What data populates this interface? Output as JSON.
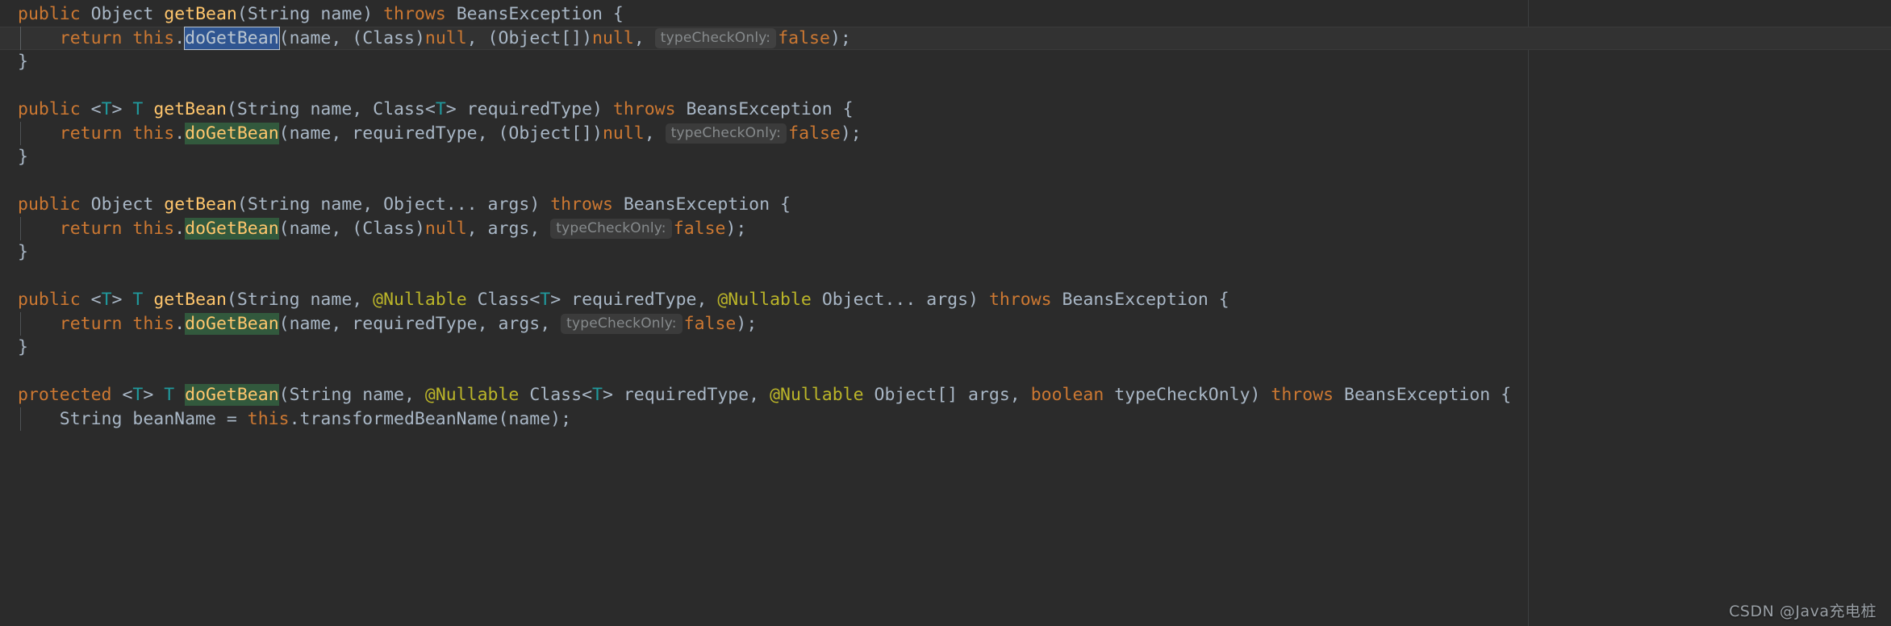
{
  "editor": {
    "theme": "darcula",
    "background": "#2b2b2b",
    "caret_line_background": "#323232",
    "right_margin_guide_x": 1894,
    "colors": {
      "keyword": "#cc7832",
      "default_text": "#a9b7c6",
      "method_declaration": "#ffc66d",
      "annotation": "#bbb529",
      "type_parameter": "#20999d",
      "usage_highlight_bg": "#32593d",
      "selection_bg": "#2f5591",
      "inline_hint_fg": "#868a8c",
      "inline_hint_bg": "#3b3b3b",
      "indent_guide": "#4f5356"
    },
    "inline_hint_label": "typeCheckOnly:",
    "lines": [
      {
        "n": 1,
        "caret": false,
        "indent_guide": false,
        "tokens": [
          {
            "t": "public",
            "c": "kw"
          },
          {
            "t": " ",
            "c": "plain"
          },
          {
            "t": "Object",
            "c": "type"
          },
          {
            "t": " ",
            "c": "plain"
          },
          {
            "t": "getBean",
            "c": "mname"
          },
          {
            "t": "(",
            "c": "plain"
          },
          {
            "t": "String",
            "c": "type"
          },
          {
            "t": " name) ",
            "c": "plain"
          },
          {
            "t": "throws",
            "c": "kw"
          },
          {
            "t": " BeansException {",
            "c": "plain"
          }
        ]
      },
      {
        "n": 2,
        "caret": true,
        "indent_guide": true,
        "tokens": [
          {
            "t": "    ",
            "c": "plain"
          },
          {
            "t": "return",
            "c": "kw"
          },
          {
            "t": " ",
            "c": "plain"
          },
          {
            "t": "this",
            "c": "kw"
          },
          {
            "t": ".",
            "c": "plain"
          },
          {
            "t": "doGetBean",
            "c": "selection"
          },
          {
            "t": "(name, (",
            "c": "plain"
          },
          {
            "t": "Class",
            "c": "type"
          },
          {
            "t": ")",
            "c": "plain"
          },
          {
            "t": "null",
            "c": "kw"
          },
          {
            "t": ", (",
            "c": "plain"
          },
          {
            "t": "Object",
            "c": "type"
          },
          {
            "t": "[])",
            "c": "plain"
          },
          {
            "t": "null",
            "c": "kw"
          },
          {
            "t": ", ",
            "c": "plain"
          },
          {
            "t": "typeCheckOnly:",
            "c": "hint"
          },
          {
            "t": "false",
            "c": "kw"
          },
          {
            "t": ");",
            "c": "plain"
          }
        ]
      },
      {
        "n": 3,
        "caret": false,
        "indent_guide": false,
        "tokens": [
          {
            "t": "}",
            "c": "plain"
          }
        ]
      },
      {
        "n": 4,
        "caret": false,
        "indent_guide": false,
        "tokens": []
      },
      {
        "n": 5,
        "caret": false,
        "indent_guide": false,
        "tokens": [
          {
            "t": "public",
            "c": "kw"
          },
          {
            "t": " <",
            "c": "plain"
          },
          {
            "t": "T",
            "c": "generic"
          },
          {
            "t": "> ",
            "c": "plain"
          },
          {
            "t": "T",
            "c": "generic"
          },
          {
            "t": " ",
            "c": "plain"
          },
          {
            "t": "getBean",
            "c": "mname"
          },
          {
            "t": "(",
            "c": "plain"
          },
          {
            "t": "String",
            "c": "type"
          },
          {
            "t": " name, ",
            "c": "plain"
          },
          {
            "t": "Class",
            "c": "type"
          },
          {
            "t": "<",
            "c": "plain"
          },
          {
            "t": "T",
            "c": "generic"
          },
          {
            "t": "> requiredType) ",
            "c": "plain"
          },
          {
            "t": "throws",
            "c": "kw"
          },
          {
            "t": " BeansException {",
            "c": "plain"
          }
        ]
      },
      {
        "n": 6,
        "caret": false,
        "indent_guide": true,
        "tokens": [
          {
            "t": "    ",
            "c": "plain"
          },
          {
            "t": "return",
            "c": "kw"
          },
          {
            "t": " ",
            "c": "plain"
          },
          {
            "t": "this",
            "c": "kw"
          },
          {
            "t": ".",
            "c": "plain"
          },
          {
            "t": "doGetBean",
            "c": "usage"
          },
          {
            "t": "(name, requiredType, (",
            "c": "plain"
          },
          {
            "t": "Object",
            "c": "type"
          },
          {
            "t": "[])",
            "c": "plain"
          },
          {
            "t": "null",
            "c": "kw"
          },
          {
            "t": ", ",
            "c": "plain"
          },
          {
            "t": "typeCheckOnly:",
            "c": "hint"
          },
          {
            "t": "false",
            "c": "kw"
          },
          {
            "t": ");",
            "c": "plain"
          }
        ]
      },
      {
        "n": 7,
        "caret": false,
        "indent_guide": false,
        "tokens": [
          {
            "t": "}",
            "c": "plain"
          }
        ]
      },
      {
        "n": 8,
        "caret": false,
        "indent_guide": false,
        "tokens": []
      },
      {
        "n": 9,
        "caret": false,
        "indent_guide": false,
        "tokens": [
          {
            "t": "public",
            "c": "kw"
          },
          {
            "t": " ",
            "c": "plain"
          },
          {
            "t": "Object",
            "c": "type"
          },
          {
            "t": " ",
            "c": "plain"
          },
          {
            "t": "getBean",
            "c": "mname"
          },
          {
            "t": "(",
            "c": "plain"
          },
          {
            "t": "String",
            "c": "type"
          },
          {
            "t": " name, ",
            "c": "plain"
          },
          {
            "t": "Object",
            "c": "type"
          },
          {
            "t": "... args) ",
            "c": "plain"
          },
          {
            "t": "throws",
            "c": "kw"
          },
          {
            "t": " BeansException {",
            "c": "plain"
          }
        ]
      },
      {
        "n": 10,
        "caret": false,
        "indent_guide": true,
        "tokens": [
          {
            "t": "    ",
            "c": "plain"
          },
          {
            "t": "return",
            "c": "kw"
          },
          {
            "t": " ",
            "c": "plain"
          },
          {
            "t": "this",
            "c": "kw"
          },
          {
            "t": ".",
            "c": "plain"
          },
          {
            "t": "doGetBean",
            "c": "usage"
          },
          {
            "t": "(name, (",
            "c": "plain"
          },
          {
            "t": "Class",
            "c": "type"
          },
          {
            "t": ")",
            "c": "plain"
          },
          {
            "t": "null",
            "c": "kw"
          },
          {
            "t": ", args, ",
            "c": "plain"
          },
          {
            "t": "typeCheckOnly:",
            "c": "hint"
          },
          {
            "t": "false",
            "c": "kw"
          },
          {
            "t": ");",
            "c": "plain"
          }
        ]
      },
      {
        "n": 11,
        "caret": false,
        "indent_guide": false,
        "tokens": [
          {
            "t": "}",
            "c": "plain"
          }
        ]
      },
      {
        "n": 12,
        "caret": false,
        "indent_guide": false,
        "tokens": []
      },
      {
        "n": 13,
        "caret": false,
        "indent_guide": false,
        "tokens": [
          {
            "t": "public",
            "c": "kw"
          },
          {
            "t": " <",
            "c": "plain"
          },
          {
            "t": "T",
            "c": "generic"
          },
          {
            "t": "> ",
            "c": "plain"
          },
          {
            "t": "T",
            "c": "generic"
          },
          {
            "t": " ",
            "c": "plain"
          },
          {
            "t": "getBean",
            "c": "mname"
          },
          {
            "t": "(",
            "c": "plain"
          },
          {
            "t": "String",
            "c": "type"
          },
          {
            "t": " name, ",
            "c": "plain"
          },
          {
            "t": "@Nullable",
            "c": "anno"
          },
          {
            "t": " ",
            "c": "plain"
          },
          {
            "t": "Class",
            "c": "type"
          },
          {
            "t": "<",
            "c": "plain"
          },
          {
            "t": "T",
            "c": "generic"
          },
          {
            "t": "> requiredType, ",
            "c": "plain"
          },
          {
            "t": "@Nullable",
            "c": "anno"
          },
          {
            "t": " ",
            "c": "plain"
          },
          {
            "t": "Object",
            "c": "type"
          },
          {
            "t": "... args) ",
            "c": "plain"
          },
          {
            "t": "throws",
            "c": "kw"
          },
          {
            "t": " BeansException {",
            "c": "plain"
          }
        ]
      },
      {
        "n": 14,
        "caret": false,
        "indent_guide": true,
        "tokens": [
          {
            "t": "    ",
            "c": "plain"
          },
          {
            "t": "return",
            "c": "kw"
          },
          {
            "t": " ",
            "c": "plain"
          },
          {
            "t": "this",
            "c": "kw"
          },
          {
            "t": ".",
            "c": "plain"
          },
          {
            "t": "doGetBean",
            "c": "usage"
          },
          {
            "t": "(name, requiredType, args, ",
            "c": "plain"
          },
          {
            "t": "typeCheckOnly:",
            "c": "hint"
          },
          {
            "t": "false",
            "c": "kw"
          },
          {
            "t": ");",
            "c": "plain"
          }
        ]
      },
      {
        "n": 15,
        "caret": false,
        "indent_guide": false,
        "tokens": [
          {
            "t": "}",
            "c": "plain"
          }
        ]
      },
      {
        "n": 16,
        "caret": false,
        "indent_guide": false,
        "tokens": []
      },
      {
        "n": 17,
        "caret": false,
        "indent_guide": false,
        "tokens": [
          {
            "t": "protected",
            "c": "kw"
          },
          {
            "t": " <",
            "c": "plain"
          },
          {
            "t": "T",
            "c": "generic"
          },
          {
            "t": "> ",
            "c": "plain"
          },
          {
            "t": "T",
            "c": "generic"
          },
          {
            "t": " ",
            "c": "plain"
          },
          {
            "t": "doGetBean",
            "c": "usage"
          },
          {
            "t": "(",
            "c": "plain"
          },
          {
            "t": "String",
            "c": "type"
          },
          {
            "t": " name, ",
            "c": "plain"
          },
          {
            "t": "@Nullable",
            "c": "anno"
          },
          {
            "t": " ",
            "c": "plain"
          },
          {
            "t": "Class",
            "c": "type"
          },
          {
            "t": "<",
            "c": "plain"
          },
          {
            "t": "T",
            "c": "generic"
          },
          {
            "t": "> requiredType, ",
            "c": "plain"
          },
          {
            "t": "@Nullable",
            "c": "anno"
          },
          {
            "t": " ",
            "c": "plain"
          },
          {
            "t": "Object",
            "c": "type"
          },
          {
            "t": "[] args, ",
            "c": "plain"
          },
          {
            "t": "boolean",
            "c": "kw"
          },
          {
            "t": " typeCheckOnly) ",
            "c": "plain"
          },
          {
            "t": "throws",
            "c": "kw"
          },
          {
            "t": " BeansException {",
            "c": "plain"
          }
        ]
      },
      {
        "n": 18,
        "caret": false,
        "indent_guide": true,
        "tokens": [
          {
            "t": "    ",
            "c": "plain"
          },
          {
            "t": "String",
            "c": "type"
          },
          {
            "t": " beanName = ",
            "c": "plain"
          },
          {
            "t": "this",
            "c": "kw"
          },
          {
            "t": ".transformedBeanName(name);",
            "c": "plain"
          }
        ]
      }
    ]
  },
  "watermark": {
    "text": "CSDN @Java充电桩"
  }
}
